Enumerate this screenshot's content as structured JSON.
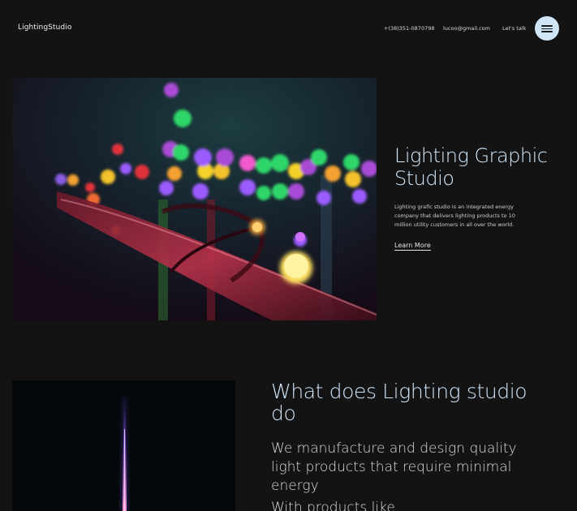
{
  "header": {
    "logo": "LightingStudio",
    "phone": "+(38)351-0870798",
    "email": "lucoo@gmail.com",
    "cta": "Let's talk",
    "menu_icon": "hamburger-icon"
  },
  "hero": {
    "title": "Lighting Graphic Studio",
    "description": "Lighting grafic studio is an integrated energy company that delivers lighting products to 10 million utility customers in all over the world.",
    "link": "Learn More",
    "image": "bokeh-string-lights-photo"
  },
  "section": {
    "title": "What does Lighting studio do",
    "description": "We manufacture and design quality light products that require minimal energy",
    "next_line": "With products like",
    "image": "neon-light-beam-photo"
  },
  "colors": {
    "background": "#131313",
    "accent": "#cfe4f5"
  }
}
